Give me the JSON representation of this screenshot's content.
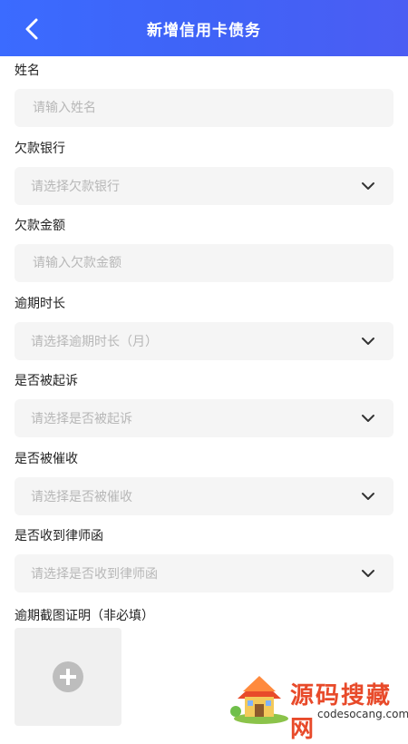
{
  "header": {
    "title": "新增信用卡债务",
    "back_icon": "chevron-left-icon"
  },
  "form": {
    "fields": [
      {
        "label": "姓名",
        "placeholder": "请输入姓名",
        "type": "input"
      },
      {
        "label": "欠款银行",
        "placeholder": "请选择欠款银行",
        "type": "select"
      },
      {
        "label": "欠款金额",
        "placeholder": "请输入欠款金额",
        "type": "input"
      },
      {
        "label": "逾期时长",
        "placeholder": "请选择逾期时长（月）",
        "type": "select"
      },
      {
        "label": "是否被起诉",
        "placeholder": "请选择是否被起诉",
        "type": "select"
      },
      {
        "label": "是否被催收",
        "placeholder": "请选择是否被催收",
        "type": "select"
      },
      {
        "label": "是否收到律师函",
        "placeholder": "请选择是否收到律师函",
        "type": "select"
      }
    ],
    "upload": {
      "label": "逾期截图证明（非必填）",
      "icon": "plus-circle-icon"
    }
  },
  "watermark": {
    "text": "源码搜藏网",
    "url": "codesocang.com"
  },
  "colors": {
    "header_start": "#3b6bff",
    "header_end": "#4b5df3",
    "field_bg": "#f5f5f5",
    "placeholder": "#b7b7b7",
    "watermark_red": "#e84a2a"
  }
}
